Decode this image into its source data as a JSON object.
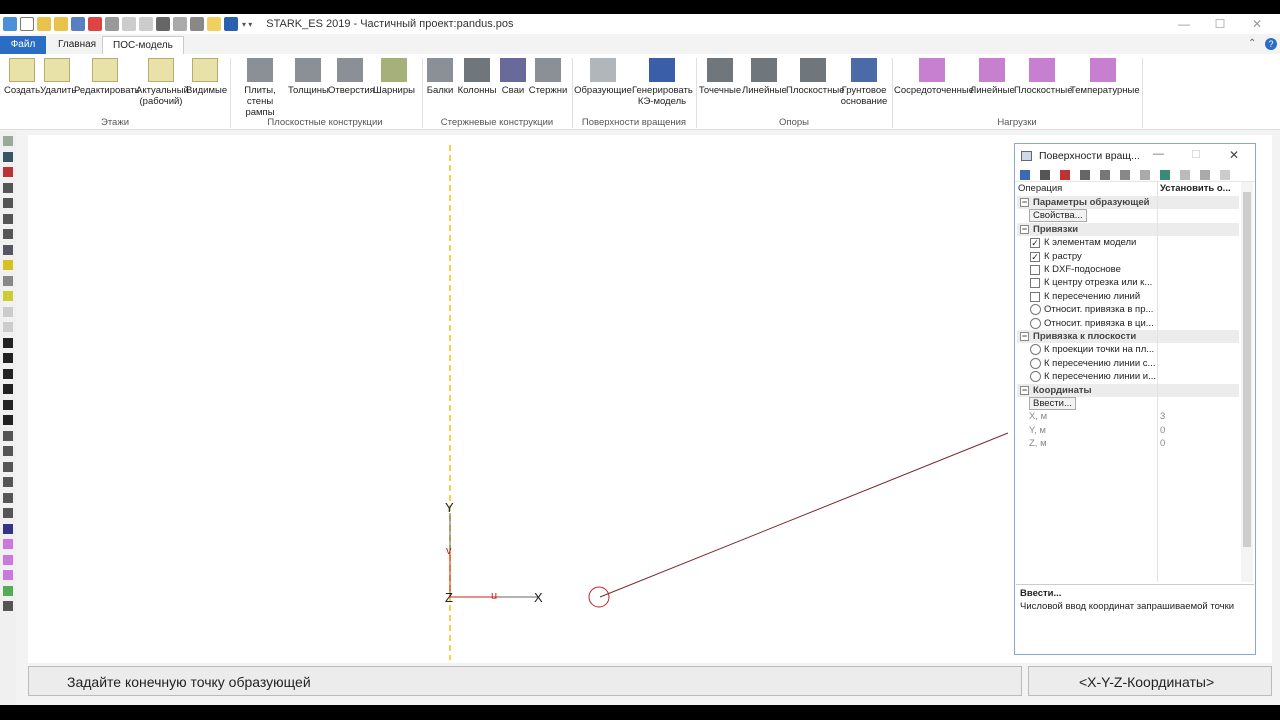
{
  "window": {
    "title": "STARK_ES 2019 - Частичный проект:pandus.pos"
  },
  "tabs": [
    {
      "label": "Файл"
    },
    {
      "label": "Главная"
    },
    {
      "label": "ПОС-модель"
    }
  ],
  "ribbon": {
    "groups": [
      {
        "label": "Этажи"
      },
      {
        "label": "Плоскостные конструкции"
      },
      {
        "label": "Стержневые конструкции"
      },
      {
        "label": "Поверхности вращения"
      },
      {
        "label": "Опоры"
      },
      {
        "label": "Нагрузки"
      }
    ],
    "buttons": [
      {
        "label": "Создать"
      },
      {
        "label": "Удалить"
      },
      {
        "label": "Редактировать"
      },
      {
        "label": "Актуальный",
        "label2": "(рабочий)"
      },
      {
        "label": "Видимые"
      },
      {
        "label": "Плиты, стены",
        "label2": "рампы"
      },
      {
        "label": "Толщины"
      },
      {
        "label": "Отверстия"
      },
      {
        "label": "Шарниры"
      },
      {
        "label": "Балки"
      },
      {
        "label": "Колонны"
      },
      {
        "label": "Сваи"
      },
      {
        "label": "Стержни"
      },
      {
        "label": "Образующие"
      },
      {
        "label": "Генерировать",
        "label2": "КЭ-модель"
      },
      {
        "label": "Точечные"
      },
      {
        "label": "Линейные"
      },
      {
        "label": "Плоскостные"
      },
      {
        "label": "Грунтовое",
        "label2": "основание"
      },
      {
        "label": "Сосредоточенные"
      },
      {
        "label": "Линейные"
      },
      {
        "label": "Плоскостные"
      },
      {
        "label": "Температурные"
      }
    ]
  },
  "canvas": {
    "axis_y": "Y",
    "axis_x": "X",
    "axis_z": "Z",
    "axis_v": "v",
    "axis_u": "u"
  },
  "panel": {
    "title": "Поверхности вращ...",
    "header_col1": "Операция",
    "header_col2": "Установить о...",
    "rows": [
      {
        "type": "cat",
        "label": "Параметры образующей"
      },
      {
        "type": "btn",
        "label": "Свойства..."
      },
      {
        "type": "cat",
        "label": "Привязки"
      },
      {
        "type": "check",
        "checked": true,
        "label": "К элементам модели"
      },
      {
        "type": "check",
        "checked": true,
        "label": "К растру"
      },
      {
        "type": "check",
        "checked": false,
        "label": "К DXF-подоснове"
      },
      {
        "type": "check",
        "checked": false,
        "label": "К центру отрезка или к..."
      },
      {
        "type": "check",
        "checked": false,
        "label": "К пересечению линий"
      },
      {
        "type": "radio",
        "label": "Относит. привязка в пр..."
      },
      {
        "type": "radio",
        "label": "Относит. привязка в ци..."
      },
      {
        "type": "cat",
        "label": "Привязка к плоскости"
      },
      {
        "type": "radio",
        "label": "К проекции точки на пл..."
      },
      {
        "type": "radio",
        "label": "К пересечению линии с..."
      },
      {
        "type": "radio",
        "label": "К пересечению линии и..."
      },
      {
        "type": "cat",
        "label": "Координаты"
      },
      {
        "type": "btn",
        "label": "Ввести..."
      },
      {
        "type": "value",
        "label": "X, м",
        "value": "3"
      },
      {
        "type": "value",
        "label": "Y, м",
        "value": "0"
      },
      {
        "type": "value",
        "label": "Z, м",
        "value": "0"
      }
    ],
    "desc_title": "Ввести...",
    "desc_text": "Числовой ввод координат запрашиваемой точки"
  },
  "status": {
    "prompt": "Задайте конечную точку образующей",
    "mode": "<X-Y-Z-Координаты>"
  },
  "colors": {
    "accent": "#2b6cc4",
    "icon_purple": "#c77fd0",
    "icon_gray": "#8a9096",
    "axis_red": "#cc2222",
    "axis_yellow": "#f2d24a"
  }
}
